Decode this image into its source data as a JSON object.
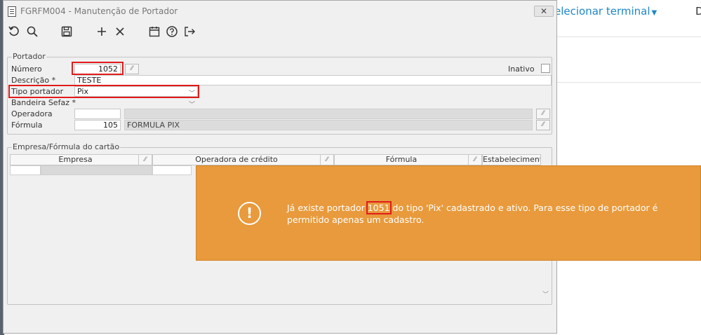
{
  "background": {
    "terminal_link": "elecionar terminal",
    "right_edge_text": "D"
  },
  "window": {
    "title": "FGRFM004 - Manutenção de Portador",
    "close_symbol": "✕"
  },
  "toolbar": {
    "buttons": [
      {
        "name": "undo-icon",
        "label": "Desfazer"
      },
      {
        "name": "search-icon",
        "label": "Pesquisar"
      },
      {
        "name": "save-icon",
        "label": "Salvar"
      },
      {
        "name": "plus-icon",
        "label": "Novo"
      },
      {
        "name": "close-icon",
        "label": "Cancelar"
      },
      {
        "name": "calendar-icon",
        "label": "Calendário"
      },
      {
        "name": "help-icon",
        "label": "Ajuda"
      },
      {
        "name": "exit-icon",
        "label": "Sair"
      }
    ]
  },
  "portador": {
    "legend": "Portador",
    "numero_label": "Número",
    "numero_value": "1052",
    "inativo_label": "Inativo",
    "descricao_label": "Descrição *",
    "descricao_value": "TESTE",
    "tipo_label": "Tipo portador",
    "tipo_value": "Pix",
    "bandeira_label": "Bandeira Sefaz *",
    "bandeira_value": "",
    "operadora_label": "Operadora",
    "operadora_value": "",
    "operadora_desc": "",
    "formula_label": "Fórmula",
    "formula_value": "105",
    "formula_desc": "FORMULA PIX"
  },
  "empresa_formula": {
    "legend": "Empresa/Fórmula do cartão",
    "columns": [
      "Empresa",
      "Operadora de crédito",
      "Fórmula",
      "Estabelecimento"
    ]
  },
  "toast": {
    "icon": "!",
    "message_prefix": "Já existe portador ",
    "message_highlight": "1051",
    "message_suffix": " do tipo 'Pix' cadastrado e ativo. Para esse tipo de portador é permitido apenas um cadastro.",
    "color": "#e89a3c"
  },
  "colors": {
    "highlight_red": "#e21b1b",
    "link_blue": "#1e88c8"
  }
}
